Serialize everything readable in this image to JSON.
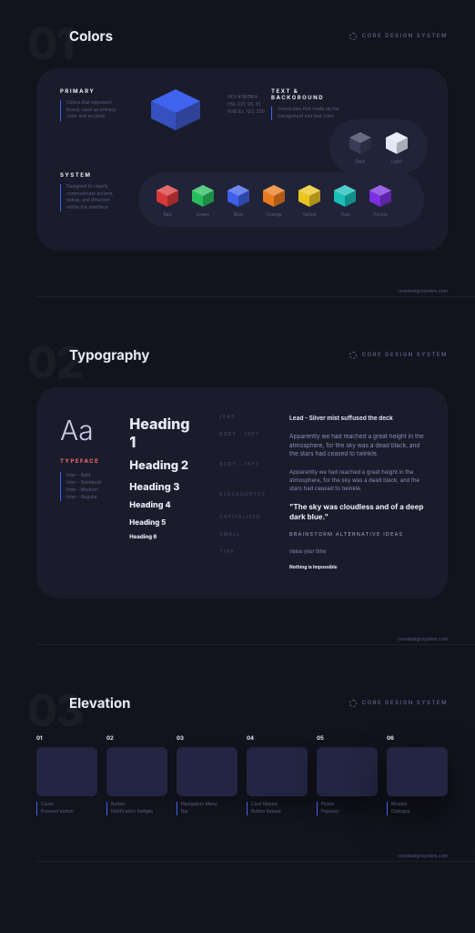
{
  "badge": "CORE DESIGN SYSTEM",
  "footer": "coredesignsystem.com",
  "sections": {
    "colors": {
      "num": "01",
      "title": "Colors"
    },
    "typography": {
      "num": "02",
      "title": "Typography"
    },
    "elevation": {
      "num": "03",
      "title": "Elevation"
    }
  },
  "colors": {
    "primary": {
      "label": "PRIMARY",
      "desc": "Colors that represent brand, used as primary color and accents.",
      "hex": "HEX #3B7BFA",
      "hsl": "HSL 221, 95, 61",
      "rgb": "RGB 62, 123, 250"
    },
    "text_bg": {
      "label": "TEXT & BACKGROUND",
      "desc": "Greyscales that made up the background and text color.",
      "items": [
        "Dark",
        "Light"
      ]
    },
    "system": {
      "label": "SYSTEM",
      "desc": "Designed to clearly communicate actions, status, and direction within the interface.",
      "items": [
        "Red",
        "Green",
        "Blue",
        "Orange",
        "Yellow",
        "Teal",
        "Purple"
      ]
    }
  },
  "typography": {
    "sample": "Aa",
    "typeface_label": "TYPEFACE",
    "weights": [
      "Inter - Bold",
      "Inter - Semibold",
      "Inter - Medium",
      "Inter - Regular"
    ],
    "headings": [
      "Heading 1",
      "Heading 2",
      "Heading 3",
      "Heading 4",
      "Heading 5",
      "Heading 6"
    ],
    "style_labels": [
      "LEAD",
      "BODY - 16PT",
      "BODY - 14PT",
      "BLOCKQUOTES",
      "CAPITALIZED",
      "SMALL",
      "TINY"
    ],
    "lead": "Lead - Silver mist suffused the deck",
    "body16": "Apparently we had reached a great height in the atmosphere, for the sky was a dead black, and the stars had ceased to twinkle.",
    "body14": "Apparently we had reached a great height in the atmosphere, for the sky was a dead black, and the stars had ceased to twinkle.",
    "quote": "\"The sky was cloudless and of a deep dark blue.\"",
    "caps": "BRAINSTORM ALTERNATIVE IDEAS",
    "small": "Value your time",
    "tiny": "Nothing is Impossible"
  },
  "elevation": {
    "levels": [
      {
        "num": "01",
        "desc": "Cards\nPressed button"
      },
      {
        "num": "02",
        "desc": "Button\nNotification badges"
      },
      {
        "num": "03",
        "desc": "Navigation Menu\nBar"
      },
      {
        "num": "04",
        "desc": "Card Raised\nButton Raised"
      },
      {
        "num": "05",
        "desc": "Picker\nPopover"
      },
      {
        "num": "06",
        "desc": "Modals\nDialogue"
      }
    ]
  },
  "swatch_colors": {
    "Dark": "#3a3e59",
    "Light": "#eef2ff",
    "Red": "#e33a3a",
    "Green": "#28c55e",
    "Blue": "#3063f0",
    "Orange": "#f5801a",
    "Yellow": "#f6cf1f",
    "Teal": "#19c7bd",
    "Purple": "#8131e8"
  }
}
